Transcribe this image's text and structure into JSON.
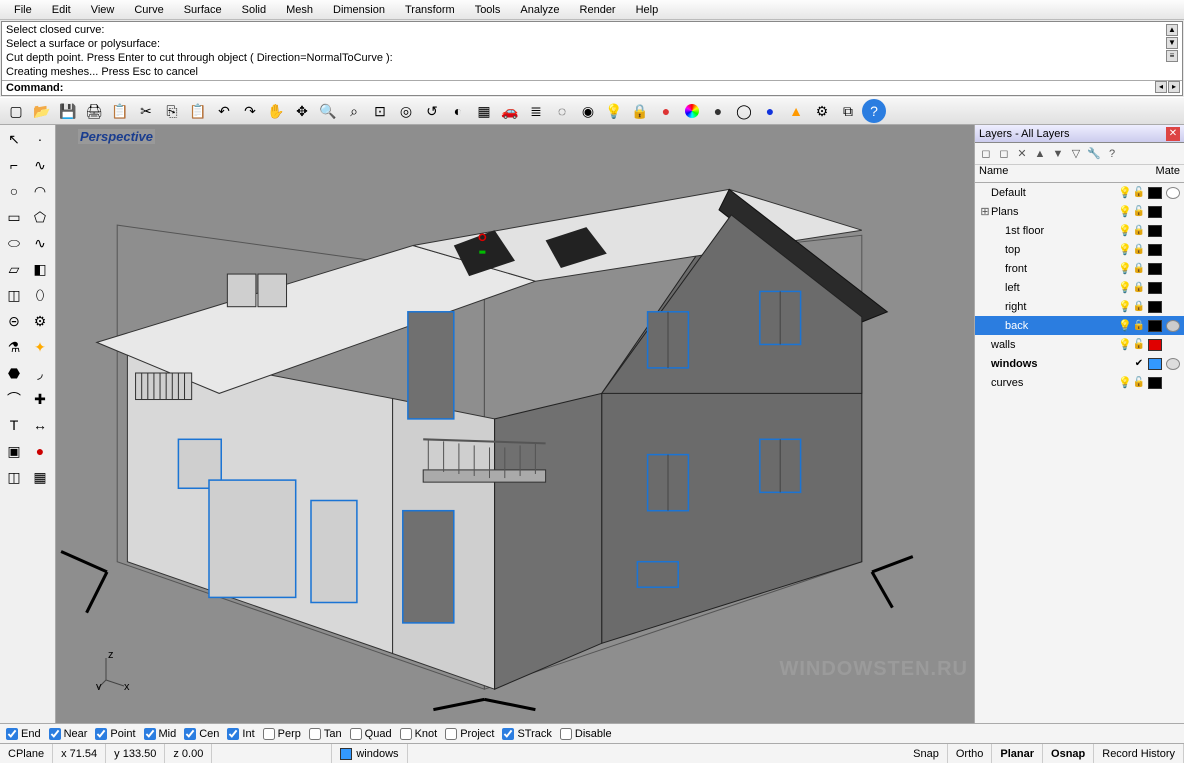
{
  "menu": [
    "File",
    "Edit",
    "View",
    "Curve",
    "Surface",
    "Solid",
    "Mesh",
    "Dimension",
    "Transform",
    "Tools",
    "Analyze",
    "Render",
    "Help"
  ],
  "cmd": {
    "history": "Select closed curve:\nSelect a surface or polysurface:\nCut depth point. Press Enter to cut through object ( Direction=NormalToCurve ):\nCreating meshes... Press Esc to cancel",
    "prompt": "Command:"
  },
  "toolbar_icons": [
    "new",
    "open",
    "save",
    "print",
    "props",
    "cut",
    "copy",
    "paste",
    "undo",
    "redo",
    "pan",
    "move",
    "zoom-in",
    "zoom-window",
    "zoom-ext",
    "zoom-sel",
    "zoom-prev",
    "zoom-dyn",
    "grid",
    "car",
    "layers",
    "hide",
    "show",
    "light",
    "lock",
    "render-red",
    "render-hsv",
    "render-dark",
    "render-wire",
    "sphere",
    "point",
    "gear",
    "group",
    "help"
  ],
  "side_icons": [
    "arrow",
    "point",
    "polyline",
    "curve2",
    "circle",
    "arc",
    "rect",
    "poly",
    "ellipse",
    "curve3",
    "srf",
    "srf2",
    "box",
    "cyl",
    "pipe",
    "gear2",
    "puzzle",
    "star",
    "blob",
    "sweep",
    "blend",
    "net",
    "text",
    "dim",
    "frame",
    "record",
    "cube",
    "mesh"
  ],
  "viewport": {
    "label": "Perspective",
    "axes": [
      "x",
      "y",
      "z"
    ]
  },
  "layers": {
    "title": "Layers - All Layers",
    "columns": [
      "Name",
      "Mate"
    ],
    "rows": [
      {
        "name": "Default",
        "indent": 0,
        "exp": "",
        "bulb": "💡",
        "lock": "🔓",
        "color": "#000000",
        "mat": "#fff"
      },
      {
        "name": "Plans",
        "indent": 0,
        "exp": "⊞",
        "bulb": "💡",
        "lock": "🔓",
        "color": "#000000",
        "mat": ""
      },
      {
        "name": "1st floor",
        "indent": 1,
        "exp": "",
        "bulb": "💡",
        "lock": "🔒",
        "color": "#000000",
        "mat": ""
      },
      {
        "name": "top",
        "indent": 1,
        "exp": "",
        "bulb": "💡",
        "lock": "🔒",
        "color": "#000000",
        "mat": ""
      },
      {
        "name": "front",
        "indent": 1,
        "exp": "",
        "bulb": "💡",
        "lock": "🔒",
        "color": "#000000",
        "mat": ""
      },
      {
        "name": "left",
        "indent": 1,
        "exp": "",
        "bulb": "💡",
        "lock": "🔒",
        "color": "#000000",
        "mat": ""
      },
      {
        "name": "right",
        "indent": 1,
        "exp": "",
        "bulb": "💡",
        "lock": "🔒",
        "color": "#000000",
        "mat": ""
      },
      {
        "name": "back",
        "indent": 1,
        "exp": "",
        "bulb": "💡",
        "lock": "🔒",
        "color": "#000000",
        "mat": "#ccc",
        "sel": true
      },
      {
        "name": "walls",
        "indent": 0,
        "exp": "",
        "bulb": "💡",
        "lock": "🔓",
        "color": "#e00000",
        "mat": ""
      },
      {
        "name": "windows",
        "indent": 0,
        "exp": "",
        "bulb": "",
        "lock": "✔",
        "color": "#3399ff",
        "mat": "#ddd",
        "bold": true
      },
      {
        "name": "curves",
        "indent": 0,
        "exp": "",
        "bulb": "💡",
        "lock": "🔓",
        "color": "#000000",
        "mat": ""
      }
    ]
  },
  "osnap": [
    {
      "label": "End",
      "checked": true
    },
    {
      "label": "Near",
      "checked": true
    },
    {
      "label": "Point",
      "checked": true
    },
    {
      "label": "Mid",
      "checked": true
    },
    {
      "label": "Cen",
      "checked": true
    },
    {
      "label": "Int",
      "checked": true
    },
    {
      "label": "Perp",
      "checked": false
    },
    {
      "label": "Tan",
      "checked": false
    },
    {
      "label": "Quad",
      "checked": false
    },
    {
      "label": "Knot",
      "checked": false
    },
    {
      "label": "Project",
      "checked": false
    },
    {
      "label": "STrack",
      "checked": true
    },
    {
      "label": "Disable",
      "checked": false
    }
  ],
  "status": {
    "cplane": "CPlane",
    "x": "x 71.54",
    "y": "y 133.50",
    "z": "z 0.00",
    "layer": "windows",
    "layercolor": "#3399ff",
    "buttons": [
      "Snap",
      "Ortho",
      "Planar",
      "Osnap",
      "Record History"
    ],
    "bold": [
      "Planar",
      "Osnap"
    ]
  },
  "watermark": "WINDOWSTEN.RU"
}
